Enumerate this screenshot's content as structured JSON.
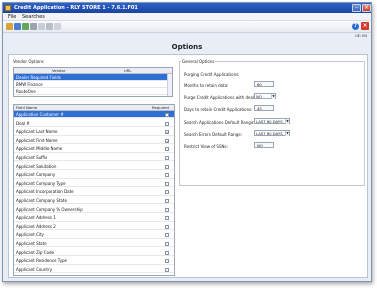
{
  "window": {
    "title": "Credit Application - RLY STORE 1 - 7.6.1.F01",
    "min_glyph": "–",
    "close_glyph": "×"
  },
  "menu": [
    "File",
    "Searches"
  ],
  "toolbar": {
    "help_glyph": "?",
    "close_glyph": "×"
  },
  "user_info": "UE: EN",
  "page_title": "Options",
  "vendor_options": {
    "legend": "Vendor Options",
    "columns": [
      "Vendor",
      "URL"
    ],
    "rows": [
      "Dealer Required Fields",
      "BMW Finance",
      "RouteOne"
    ]
  },
  "fields": {
    "columns": [
      "Field Name",
      "Required"
    ],
    "rows": [
      {
        "name": "Application Customer #",
        "checked": false
      },
      {
        "name": "Deal #",
        "checked": false
      },
      {
        "name": "Applicant Last Name",
        "checked": true
      },
      {
        "name": "Applicant First Name",
        "checked": true
      },
      {
        "name": "Applicant Middle Name",
        "checked": false
      },
      {
        "name": "Applicant Suffix",
        "checked": false
      },
      {
        "name": "Applicant Salutation",
        "checked": false
      },
      {
        "name": "Applicant Company",
        "checked": false
      },
      {
        "name": "Applicant Company Type",
        "checked": false
      },
      {
        "name": "Applicant Incorporation Date",
        "checked": false
      },
      {
        "name": "Applicant Company State",
        "checked": false
      },
      {
        "name": "Applicant Company % Ownership",
        "checked": false
      },
      {
        "name": "Applicant Address 1",
        "checked": false
      },
      {
        "name": "Applicant Address 2",
        "checked": false
      },
      {
        "name": "Applicant City",
        "checked": false
      },
      {
        "name": "Applicant State",
        "checked": false
      },
      {
        "name": "Applicant Zip Code",
        "checked": false
      },
      {
        "name": "Applicant Residence Type",
        "checked": false
      },
      {
        "name": "Applicant Country",
        "checked": false
      }
    ]
  },
  "general_options": {
    "legend": "General Options",
    "purging_label": "Purging Credit Applications:",
    "months_label": "Months to retain data:",
    "months_value": "60",
    "purge_label": "Purge Credit Applications with deals?",
    "purge_value": "NO",
    "days_label": "Days to retain Credit Applications:",
    "days_value": "45",
    "search_default_label": "Search Applications Default Range:",
    "search_default_value": "LAST 60 DAYS",
    "search_errors_label": "Search Errors Default Range:",
    "search_errors_value": "LAST 60 DAYS",
    "restrict_label": "Restrict View of SSNs:",
    "restrict_value": "NO"
  },
  "colors": {
    "titlebar": "#1a43a0",
    "selection": "#2f6fd3"
  }
}
